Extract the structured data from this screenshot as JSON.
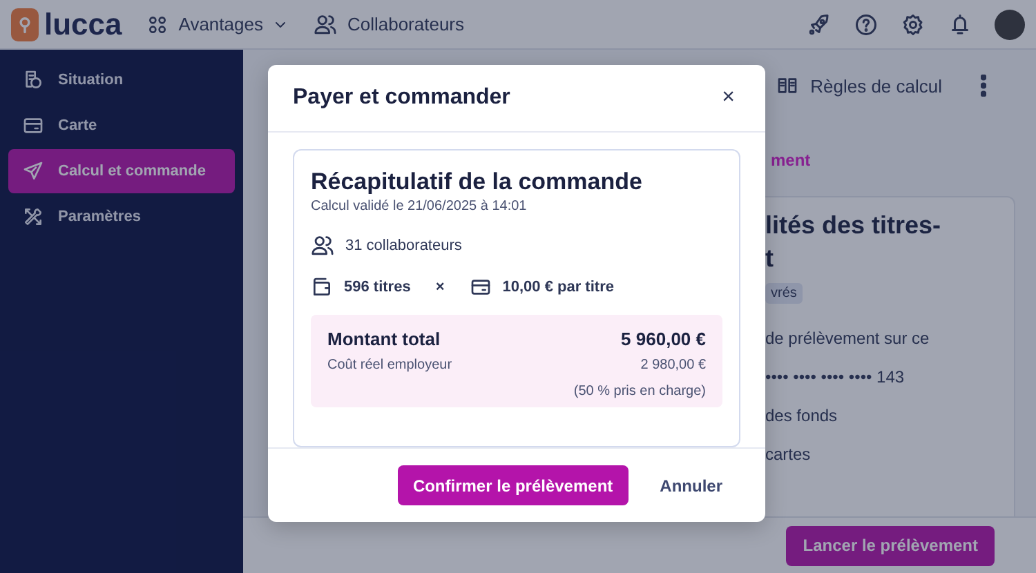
{
  "top_bar": {
    "logo": "lucca",
    "nav": [
      {
        "label": "Avantages",
        "dropdown": true
      },
      {
        "label": "Collaborateurs",
        "dropdown": false
      }
    ]
  },
  "sidebar": {
    "items": [
      {
        "label": "Situation",
        "selected": false
      },
      {
        "label": "Carte",
        "selected": false
      },
      {
        "label": "Calcul et commande",
        "selected": true
      },
      {
        "label": "Paramètres",
        "selected": false
      }
    ]
  },
  "page": {
    "action": "Règles de calcul",
    "tab": "ment",
    "card": {
      "title": "lités des titres-",
      "title_end": "t",
      "badge": "vrés",
      "lines": [
        "de prélèvement sur ce",
        "•••• •••• •••• •••• 143",
        "des fonds",
        "cartes"
      ]
    },
    "footer_button": "Lancer le prélèvement"
  },
  "modal": {
    "title": "Payer et commander",
    "close": "×",
    "summary": {
      "title": "Récapitulatif de la commande",
      "subtitle": "Calcul validé le 21/06/2025 à 14:01",
      "collaborators": "31 collaborateurs",
      "titles": "596 titres",
      "multiply": "×",
      "unit_price": "10,00 € par titre",
      "total_label": "Montant total",
      "total_amount": "5 960,00 €",
      "cost_label": "Coût réel employeur",
      "cost_amount": "2 980,00 €",
      "coverage": "(50 % pris en charge)"
    },
    "buttons": [
      {
        "label": "Confirmer le prélèvement",
        "kind": "primary"
      },
      {
        "label": "Annuler",
        "kind": "secondary"
      }
    ]
  }
}
